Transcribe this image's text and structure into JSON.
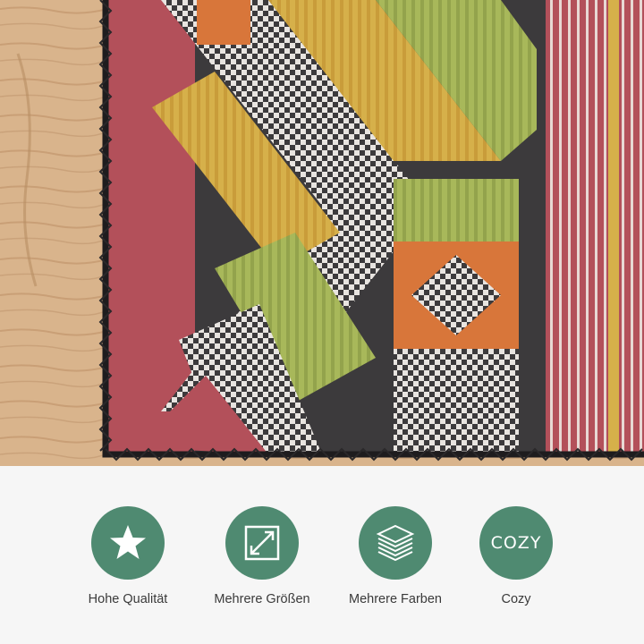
{
  "photo": {
    "subject": "close-up of patterned rug corner on wooden floor",
    "colors": {
      "wood": "#d9b48c",
      "rug_base": "#3c3a3c",
      "red": "#b3505a",
      "orange": "#d8763a",
      "yellow": "#d6b04a",
      "green": "#a8b85a",
      "white": "#e8e4e0"
    }
  },
  "features": {
    "accent_color": "#4f8a71",
    "items": [
      {
        "icon": "star-icon",
        "label": "Hohe Qualität"
      },
      {
        "icon": "resize-arrow-icon",
        "label": "Mehrere Größen"
      },
      {
        "icon": "layers-icon",
        "label": "Mehrere Farben"
      },
      {
        "icon": "cozy-text-icon",
        "icon_text": "COZY",
        "label": "Cozy"
      }
    ]
  }
}
